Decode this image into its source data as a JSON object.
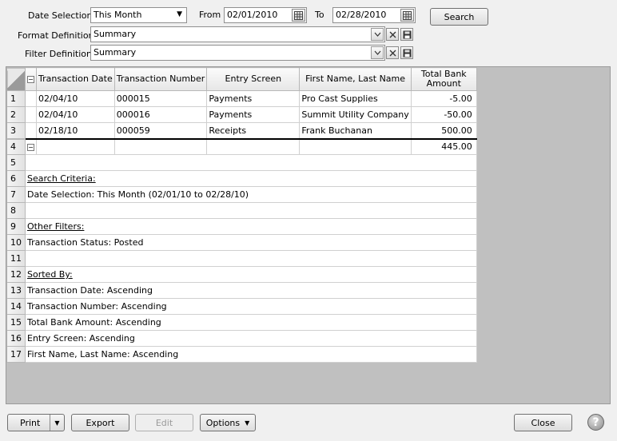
{
  "filters": {
    "date_selection_label": "Date Selection",
    "date_selection_value": "This Month",
    "from_label": "From",
    "from_value": "02/01/2010",
    "to_label": "To",
    "to_value": "02/28/2010",
    "search_label": "Search",
    "format_label": "Format Definition",
    "format_value": "Summary",
    "filter_label": "Filter Definition",
    "filter_value": "Summary"
  },
  "grid": {
    "headers": [
      "Transaction Date",
      "Transaction Number",
      "Entry Screen",
      "First Name, Last Name",
      "Total Bank Amount"
    ],
    "rows": [
      {
        "num": "1",
        "date": "02/04/10",
        "number": "000015",
        "screen": "Payments",
        "name": "Pro Cast Supplies",
        "amount": "-5.00"
      },
      {
        "num": "2",
        "date": "02/04/10",
        "number": "000016",
        "screen": "Payments",
        "name": "Summit Utility Company",
        "amount": "-50.00"
      },
      {
        "num": "3",
        "date": "02/18/10",
        "number": "000059",
        "screen": "Receipts",
        "name": "Frank Buchanan",
        "amount": "500.00"
      }
    ],
    "total_row": {
      "num": "4",
      "amount": "445.00"
    },
    "info_rows": [
      {
        "num": "5",
        "text": ""
      },
      {
        "num": "6",
        "text": "Search Criteria:",
        "style": "heading"
      },
      {
        "num": "7",
        "text": "Date Selection: This Month (02/01/10 to 02/28/10)"
      },
      {
        "num": "8",
        "text": ""
      },
      {
        "num": "9",
        "text": "Other Filters:",
        "style": "heading"
      },
      {
        "num": "10",
        "text": "Transaction Status: Posted"
      },
      {
        "num": "11",
        "text": ""
      },
      {
        "num": "12",
        "text": "Sorted By:",
        "style": "heading"
      },
      {
        "num": "13",
        "text": "Transaction Date: Ascending"
      },
      {
        "num": "14",
        "text": "Transaction Number: Ascending"
      },
      {
        "num": "15",
        "text": "Total Bank Amount: Ascending"
      },
      {
        "num": "16",
        "text": "Entry Screen: Ascending"
      },
      {
        "num": "17",
        "text": "First Name, Last Name: Ascending"
      }
    ]
  },
  "footer": {
    "print_label": "Print",
    "export_label": "Export",
    "edit_label": "Edit",
    "options_label": "Options",
    "close_label": "Close",
    "help_glyph": "?"
  },
  "icons": {
    "dropdown": "chevron-down-icon",
    "calendar": "calendar-icon",
    "clear": "close-icon",
    "save": "save-icon",
    "collapse": "minus-icon",
    "help": "help-icon"
  }
}
